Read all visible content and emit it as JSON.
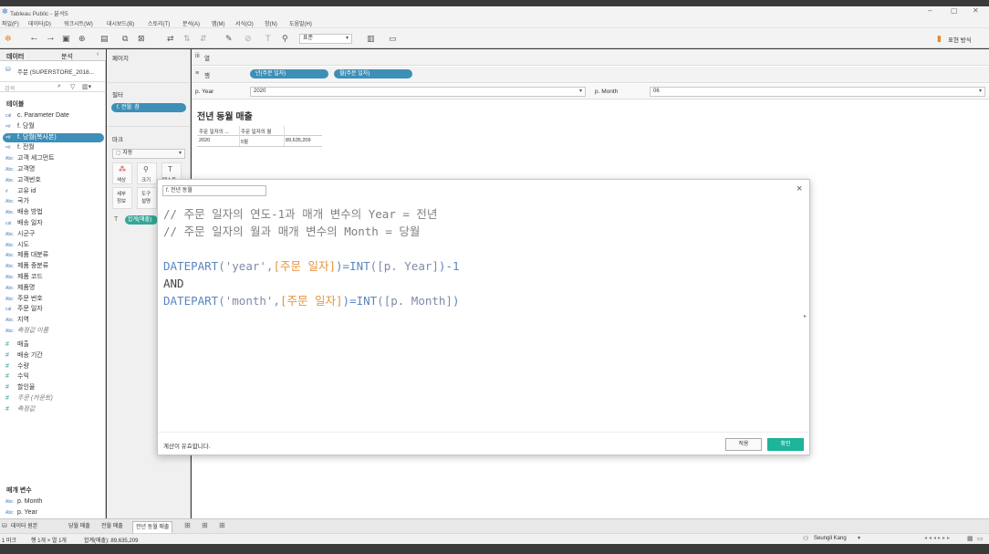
{
  "app": {
    "title": "Tableau Public - 분석5"
  },
  "menu": [
    "파일(F)",
    "데이터(D)",
    "워크시트(W)",
    "대시보드(B)",
    "스토리(T)",
    "분석(A)",
    "맵(M)",
    "서식(O)",
    "창(N)",
    "도움말(H)"
  ],
  "toolbar": {
    "fit_select": "표준",
    "show_me": "표현 방식"
  },
  "data_pane": {
    "tab_data": "데이터",
    "tab_analysis": "분석",
    "datasource": "주문 (SUPERSTORE_2018...",
    "search_placeholder": "검색",
    "tables_header": "테이블",
    "fields": [
      {
        "type": "cal",
        "name": "c. Parameter Date"
      },
      {
        "type": "=#",
        "name": "f. 당월"
      },
      {
        "type": "=#",
        "name": "f. 당월(복사본)",
        "selected": true
      },
      {
        "type": "=#",
        "name": "f. 전월"
      },
      {
        "type": "Abc",
        "name": "고객 세그먼트"
      },
      {
        "type": "Abc",
        "name": "고객명"
      },
      {
        "type": "Abc",
        "name": "고객번호"
      },
      {
        "type": "#",
        "name": "고유 id"
      },
      {
        "type": "Abc",
        "name": "국가"
      },
      {
        "type": "Abc",
        "name": "배송 방법"
      },
      {
        "type": "cal",
        "name": "배송 일자"
      },
      {
        "type": "Abc",
        "name": "시군구"
      },
      {
        "type": "Abc",
        "name": "시도"
      },
      {
        "type": "Abc",
        "name": "제품 대분류"
      },
      {
        "type": "Abc",
        "name": "제품 중분류"
      },
      {
        "type": "Abc",
        "name": "제품 코드"
      },
      {
        "type": "Abc",
        "name": "제품명"
      },
      {
        "type": "Abc",
        "name": "주문 번호"
      },
      {
        "type": "cal",
        "name": "주문 일자"
      },
      {
        "type": "Abc",
        "name": "지역"
      },
      {
        "type": "Abc",
        "name": "측정값 이름",
        "italic": true
      }
    ],
    "measures": [
      {
        "type": "#",
        "name": "매출"
      },
      {
        "type": "#",
        "name": "배송 기간"
      },
      {
        "type": "#",
        "name": "수량"
      },
      {
        "type": "#",
        "name": "수익"
      },
      {
        "type": "#",
        "name": "할인율"
      },
      {
        "type": "#",
        "name": "주문 (카운트)",
        "italic": true
      },
      {
        "type": "#",
        "name": "측정값",
        "italic": true
      }
    ],
    "params_header": "매개 변수",
    "params": [
      {
        "type": "Abc",
        "name": "p. Month"
      },
      {
        "type": "Abc",
        "name": "p. Year"
      }
    ]
  },
  "cards": {
    "pages": "페이지",
    "filters": "필터",
    "filter_pill": "f. 전월: 참",
    "marks": "마크",
    "mark_type": "자동",
    "color": "색상",
    "size": "크기",
    "text": "텍스트",
    "detail": "세부\n정보",
    "tooltip": "도구\n설명",
    "marks_pill": "합계(매출)"
  },
  "shelves": {
    "columns": "열",
    "rows": "행",
    "rows_pill_1": "년(주문 일자)",
    "rows_pill_2": "월(주문 일자)",
    "rows_icon": "≡"
  },
  "params_bar": {
    "year_label": "p. Year",
    "year_value": "2020",
    "month_label": "p. Month",
    "month_value": "06"
  },
  "view": {
    "title": "전년 동월 매출",
    "col_headers": [
      "주문 일자의 ...",
      "주문 일자의 월"
    ],
    "row": [
      "2020",
      "5월",
      "89,635,209"
    ]
  },
  "calc_dialog": {
    "name": "f. 전년 동월",
    "close": "×",
    "comment1": "// 주문 일자의 연도-1과 매개 변수의 Year = 전년",
    "comment2": "// 주문 일자의 월과 매개 변수의 Month = 당월",
    "line1": {
      "fn": "DATEPART",
      "arg": "('year',",
      "field": "[주문 일자]",
      "mid": ")=",
      "fn2": "INT",
      "param": "([p. Year]",
      "tail": ")-1"
    },
    "line2": "AND",
    "line3": {
      "fn": "DATEPART",
      "arg": "('month',",
      "field": "[주문 일자]",
      "mid": ")=",
      "fn2": "INT",
      "param": "([p. Month]",
      "tail": ")"
    },
    "status": "계산이 유효합니다.",
    "apply": "적용",
    "ok": "확인"
  },
  "sheet_tabs": [
    "데이터 원본",
    "당월 매출",
    "전월 매출",
    "전년 동월 매출"
  ],
  "status_bar": {
    "marks": "1 마크",
    "rows_cols": "행 1개 × 열 1개",
    "sum": "합계(매출): 89,635,209",
    "user": "Seungil Kang"
  }
}
